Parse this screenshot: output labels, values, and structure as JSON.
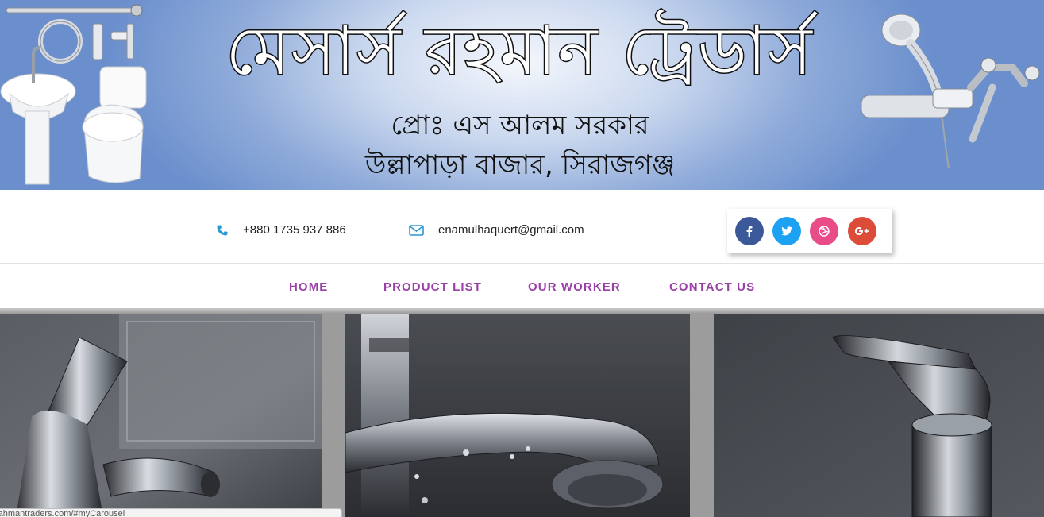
{
  "banner": {
    "title": "মেসার্স রহমান ট্রেডার্স",
    "proprietor": "প্রোঃ এস আলম সরকার",
    "address": "উল্লাপাড়া বাজার, সিরাজগঞ্জ"
  },
  "contact": {
    "phone_icon": "phone-icon",
    "phone": "+880 1735 937 886",
    "email_icon": "envelope-icon",
    "email": "enamulhaquert@gmail.com"
  },
  "social": [
    {
      "name": "facebook-icon",
      "color": "#3b5998"
    },
    {
      "name": "twitter-icon",
      "color": "#1da1f2"
    },
    {
      "name": "dribbble-icon",
      "color": "#ea4c89"
    },
    {
      "name": "google-plus-icon",
      "color": "#dd4b39"
    }
  ],
  "nav": {
    "home": "HOME",
    "product_list": "PRODUCT LIST",
    "our_worker": "OUR WORKER",
    "contact_us": "CONTACT US",
    "color": "#9b3fa8"
  },
  "status": {
    "url": "rahmantraders.com/#myCarousel"
  }
}
